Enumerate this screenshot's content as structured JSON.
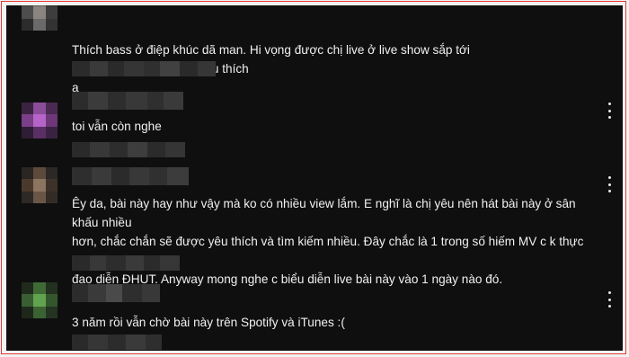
{
  "comments": [
    {
      "text": "Thích bass ở điệp khúc dã man. Hi vọng được chị live ở live show sắp tới",
      "text_after_emoji": " Với e đây vẫn là bài yêu thích\nạ",
      "emoji": "smiling-face-icon"
    },
    {
      "text": "toi vẫn còn nghe"
    },
    {
      "text": "Êy da, bài này hay như vậy mà ko có nhiều view lắm. E nghĩ là chị yêu nên hát bài này ở sân khấu nhiều\nhơn, chắc chắn sẽ được yêu thích và tìm kiếm nhiều. Đây chắc là 1 trong số hiếm MV c k thực hiện cùng\nđạo diễn ĐHUT. Anyway mong nghe c biểu diễn live bài này vào 1 ngày nào đó."
    },
    {
      "text": "3 năm rồi vẫn chờ bài này trên Spotify và iTunes :("
    }
  ],
  "colors": {
    "background": "#0f0f0f",
    "text": "#f1f1f1",
    "frame_border": "#e53935"
  }
}
